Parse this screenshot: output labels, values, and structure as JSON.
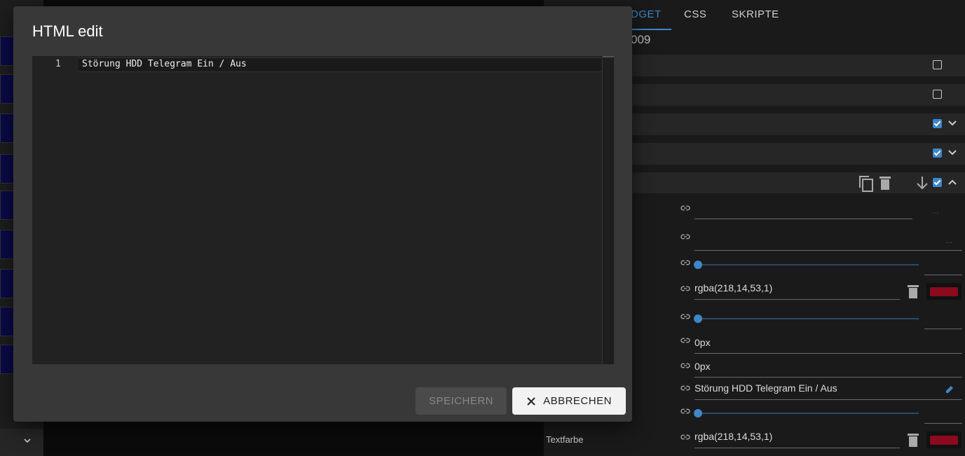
{
  "background_panel": {
    "tabs": [
      {
        "label": "WIDGET",
        "visible_label": "DGET",
        "active": true
      },
      {
        "label": "CSS",
        "active": false
      },
      {
        "label": "SKRIPTE",
        "active": false
      }
    ],
    "subtitle": "009",
    "fields": {
      "color_value_1": "rgba(218,14,53,1)",
      "padding_1": "0px",
      "padding_2": "0px",
      "html_value": "Störung HDD Telegram Ein / Aus",
      "color_value_2": "rgba(218,14,53,1)",
      "textfarbe_label": "Textfarbe"
    },
    "swatch_color": "#8a0a1e"
  },
  "dialog": {
    "title": "HTML edit",
    "editor": {
      "line_number": "1",
      "code": "Störung HDD Telegram Ein / Aus"
    },
    "buttons": {
      "save_label": "SPEICHERN",
      "cancel_label": "ABBRECHEN"
    }
  },
  "colors": {
    "accent": "#3d87c8",
    "dialog_bg": "#383838",
    "editor_bg": "#222222"
  }
}
